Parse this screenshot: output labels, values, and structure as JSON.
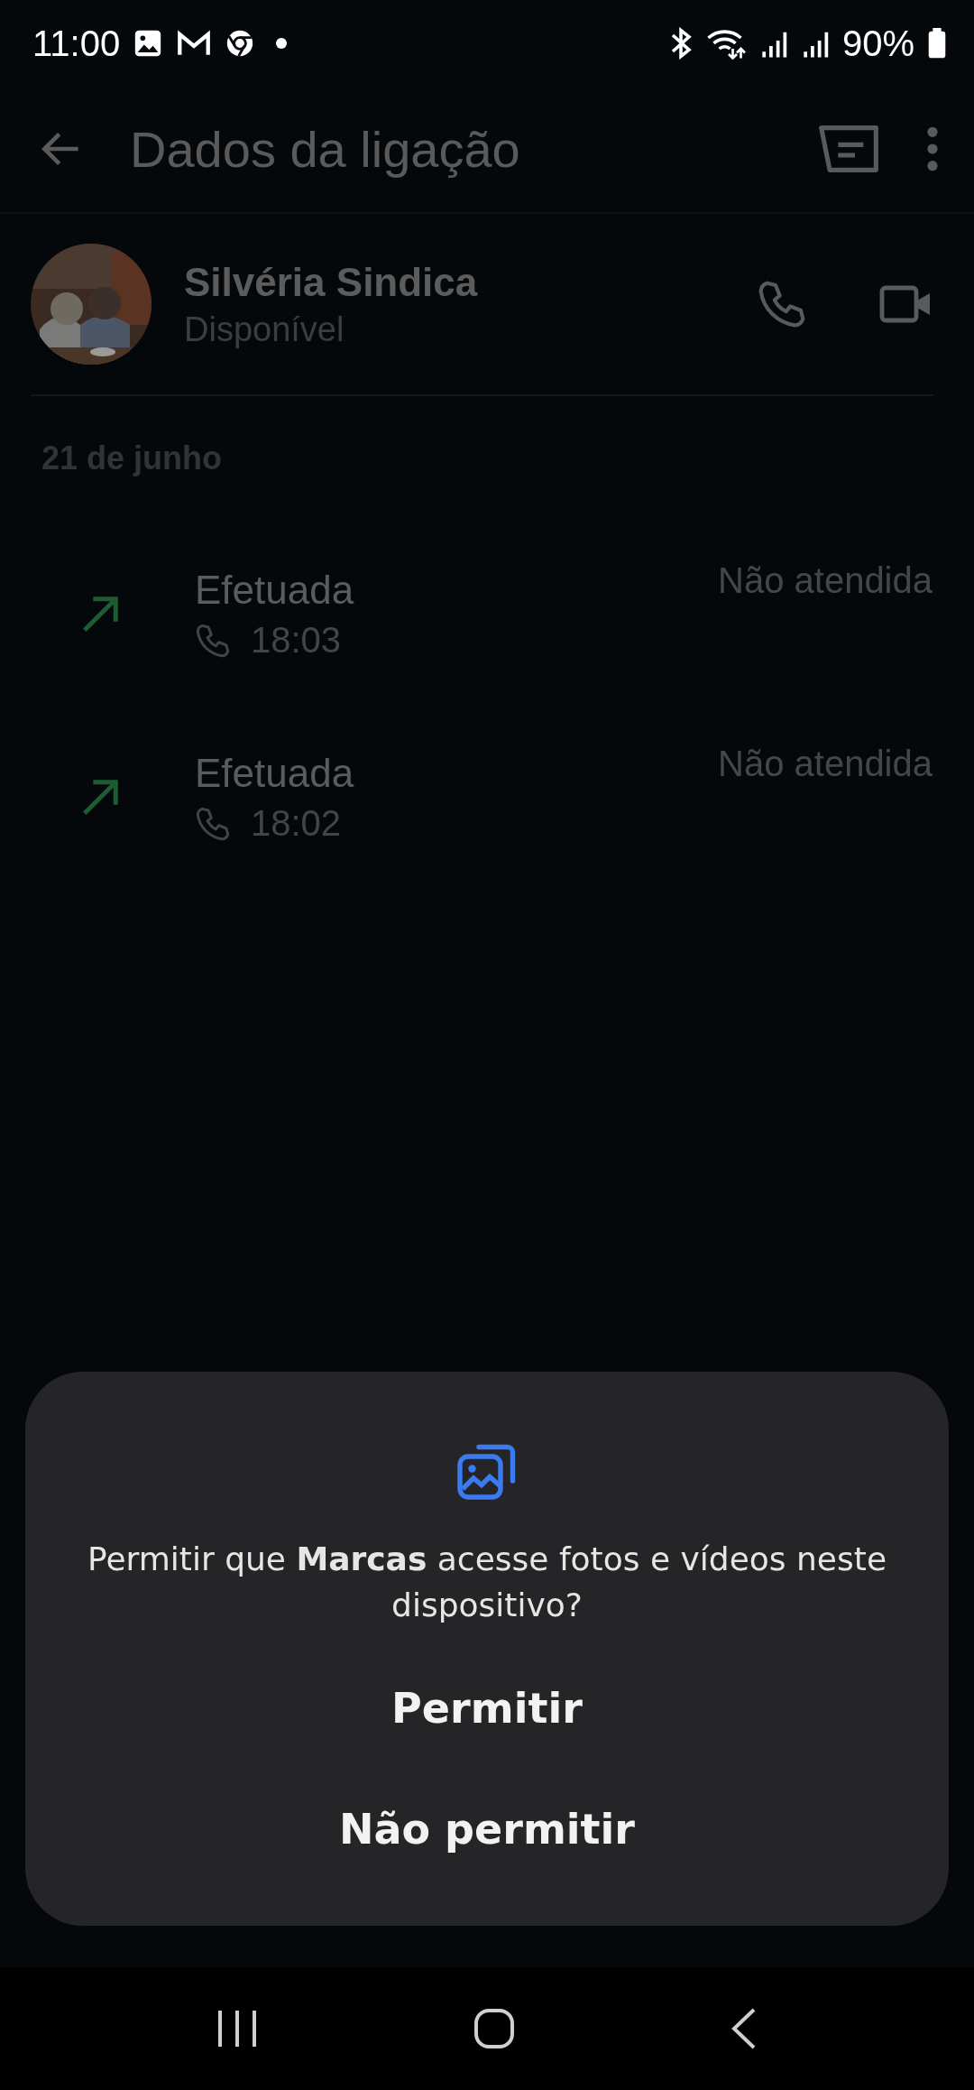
{
  "status_bar": {
    "time": "11:00",
    "battery": "90%"
  },
  "app_bar": {
    "title": "Dados da ligação"
  },
  "contact": {
    "name": "Silvéria Sindica",
    "status": "Disponível"
  },
  "call_log": {
    "date": "21 de junho",
    "calls": [
      {
        "type": "Efetuada",
        "time": "18:03",
        "result": "Não atendida",
        "kind": "outgoing"
      },
      {
        "type": "Efetuada",
        "time": "18:02",
        "result": "Não atendida",
        "kind": "outgoing"
      }
    ]
  },
  "dialog": {
    "message": "Permitir que **Marcas** acesse fotos e vídeos neste dispositivo?",
    "buttons": [
      "Permitir",
      "Não permitir"
    ]
  }
}
